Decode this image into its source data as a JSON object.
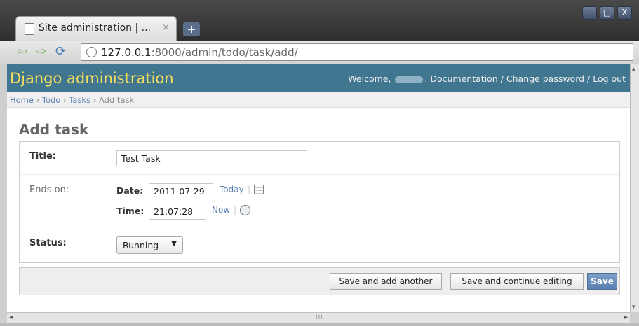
{
  "browser": {
    "tab_title": "Site administration | ...",
    "tab_close": "×",
    "new_tab": "+",
    "url_host": "127.0.0.1",
    "url_rest": ":8000/admin/todo/task/add/",
    "window_buttons": [
      "–",
      "□",
      "X"
    ]
  },
  "admin": {
    "branding": "Django administration",
    "welcome": "Welcome,",
    "user_tools": ". Documentation / Change password / Log out"
  },
  "breadcrumbs": {
    "home": "Home",
    "sep": " › ",
    "app": "Todo",
    "model": "Tasks",
    "current": "Add task"
  },
  "page_title": "Add task",
  "form": {
    "title_label": "Title:",
    "title_value": "Test Task",
    "ends_on_label": "Ends on:",
    "date_label": "Date:",
    "date_value": "2011-07-29",
    "today_link": "Today",
    "link_sep": "|",
    "time_label": "Time:",
    "time_value": "21:07:28",
    "now_link": "Now",
    "status_label": "Status:",
    "status_value": "Running",
    "status_caret": "▼"
  },
  "submit": {
    "save_add_another": "Save and add another",
    "save_continue": "Save and continue editing",
    "save": "Save"
  },
  "scrollbar": {
    "grip": "III",
    "left": "◂",
    "right": "▸",
    "up": "▴",
    "down": "▾"
  }
}
